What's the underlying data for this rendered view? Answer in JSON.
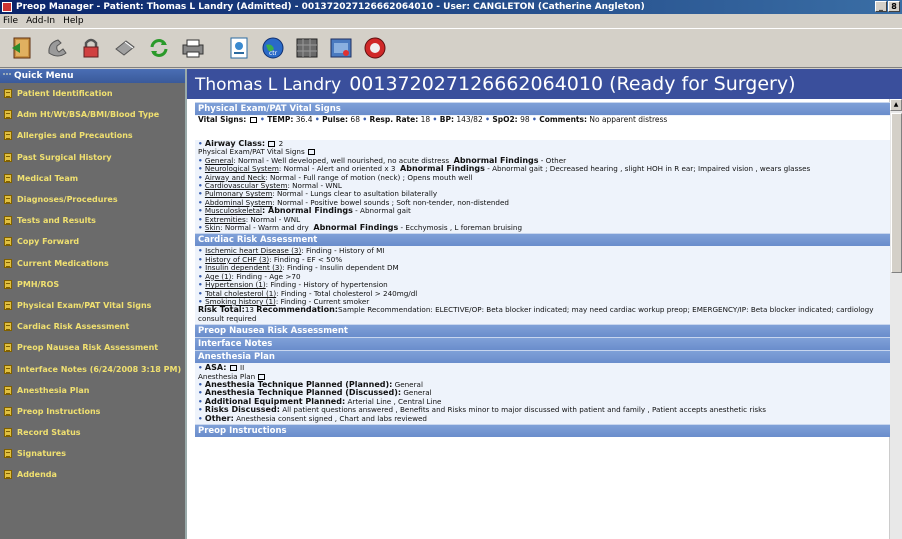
{
  "window": {
    "title": "Preop Manager - Patient: Thomas L Landry (Admitted) - 001372027126662064010 - User: CANGLETON (Catherine Angleton)",
    "min_label": "_",
    "max_label": "8",
    "close_label": "×"
  },
  "menu": [
    "File",
    "Add-In",
    "Help"
  ],
  "toolbar": {
    "icons": [
      "exit-door-icon",
      "telephone-icon",
      "lock-icon",
      "pill-icon",
      "refresh-icon",
      "printers-icon",
      "document-icon",
      "globe-icon",
      "calendar-grid-icon",
      "database-icon",
      "red-disc-icon"
    ]
  },
  "sidebar": {
    "header": "Quick Menu",
    "items": [
      "Patient Identification",
      "Adm Ht/Wt/BSA/BMI/Blood Type",
      "Allergies and Precautions",
      "Past Surgical History",
      "Medical Team",
      "Diagnoses/Procedures",
      "Tests and Results",
      "Copy Forward",
      "Current Medications",
      "PMH/ROS",
      "Physical Exam/PAT Vital Signs",
      "Cardiac Risk Assessment",
      "Preop Nausea Risk Assessment",
      "Interface Notes (6/24/2008 3:18 PM)",
      "Anesthesia Plan",
      "Preop Instructions",
      "Record Status",
      "Signatures",
      "Addenda"
    ]
  },
  "banner": {
    "name": "Thomas L Landry",
    "status": "001372027126662064010 (Ready for Surgery)"
  },
  "physical": {
    "header": "Physical Exam/PAT Vital Signs",
    "vitals_label": "Vital Signs:",
    "temp_label": "TEMP:",
    "temp": "36.4",
    "pulse_label": "Pulse:",
    "pulse": "68",
    "resp_label": "Resp. Rate:",
    "resp": "18",
    "bp_label": "BP:",
    "bp": "143/82",
    "spo2_label": "SpO2:",
    "spo2": "98",
    "comments_label": "Comments:",
    "comments": "No apparent distress",
    "airway_label": "Airway Class:",
    "airway": "2",
    "sub": "Physical Exam/PAT Vital Signs",
    "general_l": "General",
    "general": ": Normal - Well developed, well nourished, no acute distress",
    "general_af_l": "Abnormal Findings",
    "general_af": " - Other",
    "neuro_l": "Neurological System",
    "neuro": ": Normal - Alert and oriented x 3",
    "neuro_af_l": "Abnormal Findings",
    "neuro_af": " - Abnormal gait ; Decreased hearing , slight HOH in R ear; Impaired vision , wears glasses",
    "airway_l": "Airway and Neck",
    "airway_t": ": Normal - Full range of motion (neck) ; Opens mouth well",
    "cardio_l": "Cardiovascular System",
    "cardio": ": Normal - WNL",
    "pulm_l": "Pulmonary System",
    "pulm": ": Normal - Lungs clear to asultation bilaterally",
    "abd_l": "Abdominal System",
    "abd": ": Normal - Positive bowel sounds ; Soft non-tender, non-distended",
    "msk_l": "Musculoskeletal",
    "msk": ": Abnormal Findings",
    "msk_af": " - Abnormal gait",
    "ext_l": "Extremities",
    "ext": ": Normal - WNL",
    "skin_l": "Skin",
    "skin": ": Normal - Warm and dry",
    "skin_af_l": "Abnormal Findings",
    "skin_af": " - Ecchymosis , L foreman bruising"
  },
  "cardiac": {
    "header": "Cardiac Risk Assessment",
    "items": [
      {
        "l": "Ischemic heart Disease (3)",
        "t": ": Finding - History of MI"
      },
      {
        "l": "History of CHF (3)",
        "t": ": Finding - EF < 50%"
      },
      {
        "l": "Insulin dependent (3)",
        "t": ": Finding - Insulin dependent DM"
      },
      {
        "l": "Age (1)",
        "t": ": Finding - Age >70"
      },
      {
        "l": "Hypertension (1)",
        "t": ": Finding - History of hypertension"
      },
      {
        "l": "Total cholesterol (1)",
        "t": ": Finding - Total cholesterol > 240mg/dl"
      },
      {
        "l": "Smoking history (1)",
        "t": ": Finding - Current smoker"
      }
    ],
    "risk_label": "Risk Total:",
    "risk": "13",
    "rec_label": "Recommendation:",
    "rec": "Sample Recommendation: ELECTIVE/OP: Beta blocker indicated; may need cardiac workup preop; EMERGENCY/IP: Beta blocker indicated; cardiology consult required"
  },
  "nausea": {
    "header": "Preop Nausea Risk Assessment"
  },
  "interface": {
    "header": "Interface Notes"
  },
  "anesthesia": {
    "header": "Anesthesia Plan",
    "asa_label": "ASA:",
    "asa": "II",
    "sub": "Anesthesia Plan",
    "planned_label": "Anesthesia Technique Planned (Planned):",
    "planned": " General",
    "discussed_label": "Anesthesia Technique Planned (Discussed):",
    "discussed": " General",
    "equip_label": "Additional Equipment Planned:",
    "equip": " Arterial Line , Central Line",
    "risks_label": "Risks Discussed:",
    "risks": " All patient questions answered , Benefits and Risks minor to major discussed with patient and family , Patient accepts anesthetic risks",
    "other_label": "Other:",
    "other": " Anesthesia consent signed , Chart and labs reviewed"
  },
  "instructions": {
    "header": "Preop Instructions"
  },
  "colors": {
    "accent": "#3a4f9c",
    "section": "#6a8dcc",
    "sidebar": "#6b6b6b",
    "sidebar_text": "#f0e070"
  }
}
